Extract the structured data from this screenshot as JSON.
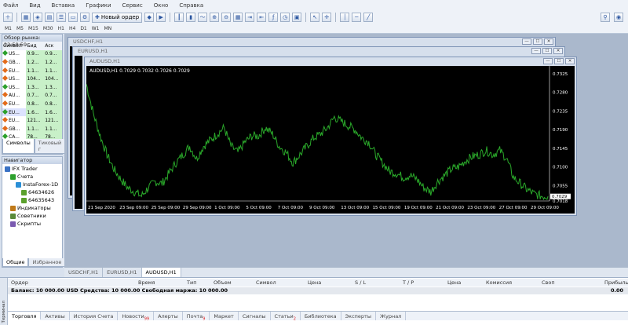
{
  "menu": [
    "Файл",
    "Вид",
    "Вставка",
    "Графики",
    "Сервис",
    "Окно",
    "Справка"
  ],
  "toolbar": {
    "new_order": "Новый ордер"
  },
  "timeframes": [
    "M1",
    "M5",
    "M15",
    "M30",
    "H1",
    "H4",
    "D1",
    "W1",
    "MN"
  ],
  "market_watch": {
    "title": "Обзор рынка: 22:59:59",
    "headers": [
      "Символ",
      "Бид",
      "Аск"
    ],
    "rows": [
      {
        "symbol": "US...",
        "bid": "0.9...",
        "ask": "0.9...",
        "color": "#2ca02c"
      },
      {
        "symbol": "GB...",
        "bid": "1.2...",
        "ask": "1.2...",
        "color": "#e36b1a"
      },
      {
        "symbol": "EU...",
        "bid": "1.1...",
        "ask": "1.1...",
        "color": "#e36b1a"
      },
      {
        "symbol": "US...",
        "bid": "104...",
        "ask": "104...",
        "color": "#e36b1a"
      },
      {
        "symbol": "US...",
        "bid": "1.3...",
        "ask": "1.3...",
        "color": "#2ca02c"
      },
      {
        "symbol": "AU...",
        "bid": "0.7...",
        "ask": "0.7...",
        "color": "#e36b1a"
      },
      {
        "symbol": "EU...",
        "bid": "0.8...",
        "ask": "0.8...",
        "color": "#e36b1a"
      },
      {
        "symbol": "EU...",
        "bid": "1.6...",
        "ask": "1.6...",
        "color": "#2ca02c"
      },
      {
        "symbol": "EU...",
        "bid": "121...",
        "ask": "121...",
        "color": "#e36b1a"
      },
      {
        "symbol": "GB...",
        "bid": "1.1...",
        "ask": "1.1...",
        "color": "#e36b1a"
      },
      {
        "symbol": "CA...",
        "bid": "78...",
        "ask": "78...",
        "color": "#2ca02c"
      }
    ],
    "tabs": [
      "Символы",
      "Тиковый г"
    ]
  },
  "navigator": {
    "title": "Навигатор",
    "items": [
      {
        "label": "IFX Trader",
        "level": 0
      },
      {
        "label": "Счета",
        "level": 1
      },
      {
        "label": "InstaForex-1D",
        "level": 2
      },
      {
        "label": "64634626",
        "level": 3
      },
      {
        "label": "64635643",
        "level": 3
      },
      {
        "label": "Индикаторы",
        "level": 1
      },
      {
        "label": "Советники",
        "level": 1
      },
      {
        "label": "Скрипты",
        "level": 1
      }
    ],
    "tabs": [
      "Общие",
      "Избранное"
    ]
  },
  "windows": [
    {
      "title": "USDCHF,H1"
    },
    {
      "title": "EURUSD,H1"
    },
    {
      "title": "AUDUSD,H1"
    }
  ],
  "chart_data": {
    "type": "line",
    "title": "AUDUSD,H1  0.7029 0.7032 0.7026 0.7029",
    "current_price": "0.7029",
    "ylim": [
      0.7018,
      0.7325
    ],
    "y_ticks": [
      "0.7325",
      "0.7280",
      "0.7235",
      "0.7190",
      "0.7145",
      "0.7100",
      "0.7055",
      "0.7018"
    ],
    "x_ticks": [
      "21 Sep 2020",
      "23 Sep 09:00",
      "25 Sep 09:00",
      "29 Sep 09:00",
      "1 Oct 09:00",
      "5 Oct 09:00",
      "7 Oct 09:00",
      "9 Oct 09:00",
      "13 Oct 09:00",
      "15 Oct 09:00",
      "19 Oct 09:00",
      "21 Oct 09:00",
      "23 Oct 09:00",
      "27 Oct 09:00",
      "29 Oct 09:00"
    ],
    "series": [
      {
        "values": [
          0.73,
          0.723,
          0.7175,
          0.713,
          0.7095,
          0.707,
          0.705,
          0.704,
          0.703,
          0.705,
          0.7065,
          0.706,
          0.7085,
          0.711,
          0.713,
          0.715,
          0.712,
          0.715,
          0.7165,
          0.718,
          0.7195,
          0.715,
          0.7135,
          0.716,
          0.7175,
          0.7175,
          0.7195,
          0.718,
          0.715,
          0.7135,
          0.711,
          0.713,
          0.715,
          0.717,
          0.718,
          0.7195,
          0.722,
          0.721,
          0.72,
          0.719,
          0.717,
          0.716,
          0.713,
          0.711,
          0.709,
          0.7085,
          0.7075,
          0.708,
          0.707,
          0.705,
          0.704,
          0.7065,
          0.708,
          0.7095,
          0.71,
          0.7115,
          0.7125,
          0.713,
          0.714,
          0.713,
          0.714,
          0.712,
          0.7075,
          0.706,
          0.7045,
          0.7035,
          0.703,
          0.7029
        ]
      }
    ]
  },
  "doc_tabs": [
    "USDCHF,H1",
    "EURUSD,H1",
    "AUDUSD,H1"
  ],
  "terminal": {
    "side_label": "Терминал",
    "headers": [
      "Ордер",
      "Время",
      "Тип",
      "Объем",
      "Символ",
      "Цена",
      "S / L",
      "T / P",
      "Цена",
      "Комиссия",
      "Своп",
      "Прибыль"
    ],
    "balance": "Баланс: 10 000.00 USD  Средства: 10 000.00  Свободная маржа: 10 000.00",
    "balance_value": "0.00",
    "tabs": [
      {
        "label": "Торговля",
        "badge": ""
      },
      {
        "label": "Активы",
        "badge": ""
      },
      {
        "label": "История Счета",
        "badge": ""
      },
      {
        "label": "Новости",
        "badge": "99"
      },
      {
        "label": "Алерты",
        "badge": ""
      },
      {
        "label": "Почта",
        "badge": "9"
      },
      {
        "label": "Маркет",
        "badge": ""
      },
      {
        "label": "Сигналы",
        "badge": ""
      },
      {
        "label": "Статьи",
        "badge": "2"
      },
      {
        "label": "Библиотека",
        "badge": ""
      },
      {
        "label": "Эксперты",
        "badge": ""
      },
      {
        "label": "Журнал",
        "badge": ""
      }
    ]
  }
}
